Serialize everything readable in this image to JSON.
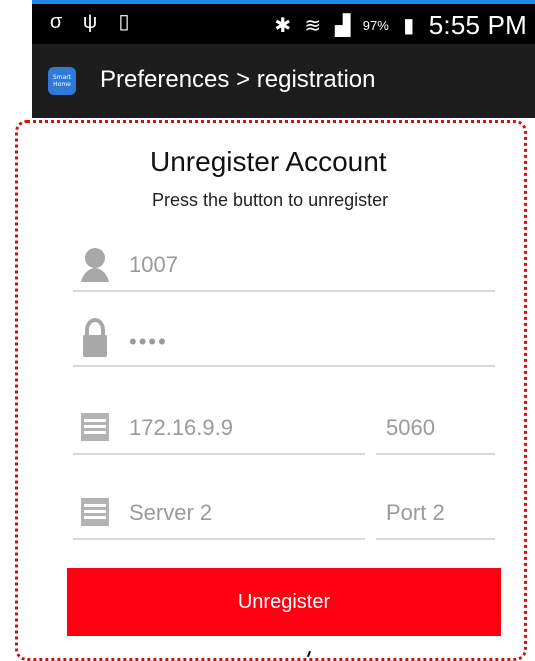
{
  "status_bar": {
    "battery_percent": "97%",
    "time": "5:55 PM",
    "left_icons": [
      "sigma-icon",
      "usb-icon",
      "clipboard-icon"
    ],
    "right_icons": [
      "bluetooth-icon",
      "wifi-icon",
      "signal-icon",
      "battery-icon"
    ]
  },
  "app_bar": {
    "logo_text": "Smart Home",
    "title": "Preferences > registration"
  },
  "main": {
    "heading": "Unregister Account",
    "subheading": "Press the button to unregister",
    "fields": {
      "user": "1007",
      "password": "••••",
      "server1": "172.16.9.9",
      "port1": "5060",
      "server2": "Server 2",
      "port2": "Port 2"
    },
    "button_label": "Unregister"
  },
  "colors": {
    "accent_blue": "#1e88e5",
    "button_red": "#ff0013",
    "outline_red": "#d21010"
  }
}
